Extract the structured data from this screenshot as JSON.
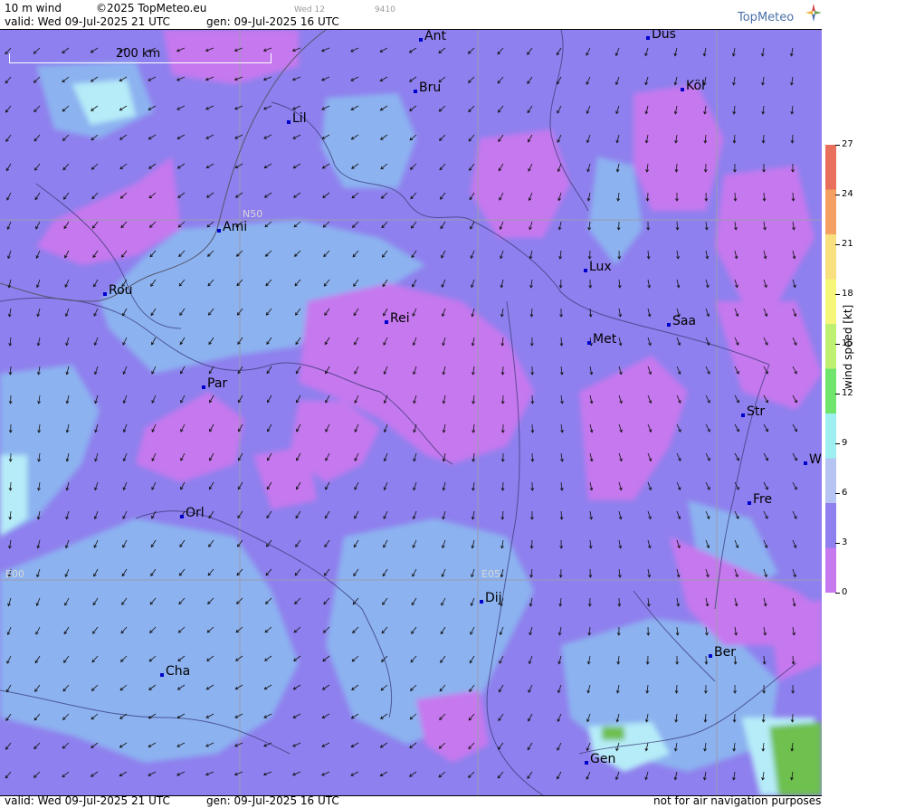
{
  "header": {
    "product": "10 m wind",
    "copyright": "©2025 TopMeteo.eu",
    "valid": "valid:  Wed  09-Jul-2025  21 UTC",
    "generated": "gen: 09-Jul-2025 16 UTC",
    "day_code": "Wed 12",
    "run_code": "9410",
    "logo_text": "TopMeteo"
  },
  "map": {
    "scale_label": "200 km",
    "grid_labels": [
      "N50",
      "E00",
      "E05"
    ],
    "cities": [
      "Ant",
      "Düs",
      "Bru",
      "Köl",
      "Lil",
      "Ami",
      "Rou",
      "Lux",
      "Rei",
      "Saa",
      "Met",
      "Par",
      "Str",
      "W",
      "Fre",
      "Orl",
      "Dij",
      "Ber",
      "Cha",
      "Gen"
    ],
    "colors": {
      "calm": "#c678ee",
      "light": "#8e80ee",
      "moderate": "#8cb2f0",
      "fresh": "#b6ecf8",
      "strong": "#6ec050"
    }
  },
  "legend": {
    "title": "wind  speed  [kt]",
    "unit": "kt",
    "ticks": [
      "27",
      "24",
      "21",
      "18",
      "15",
      "12",
      "9",
      "6",
      "3",
      "0"
    ],
    "colors": [
      "#e8705c",
      "#f3a062",
      "#f8e07e",
      "#f6f67a",
      "#c0f072",
      "#6fe56d",
      "#9ef0f0",
      "#b6c4f4",
      "#8e80ee",
      "#c678ee"
    ]
  },
  "footer": {
    "valid": "valid:  Wed  09-Jul-2025  21 UTC",
    "generated": "gen: 09-Jul-2025 16 UTC",
    "disclaimer": "not for air navigation purposes"
  }
}
